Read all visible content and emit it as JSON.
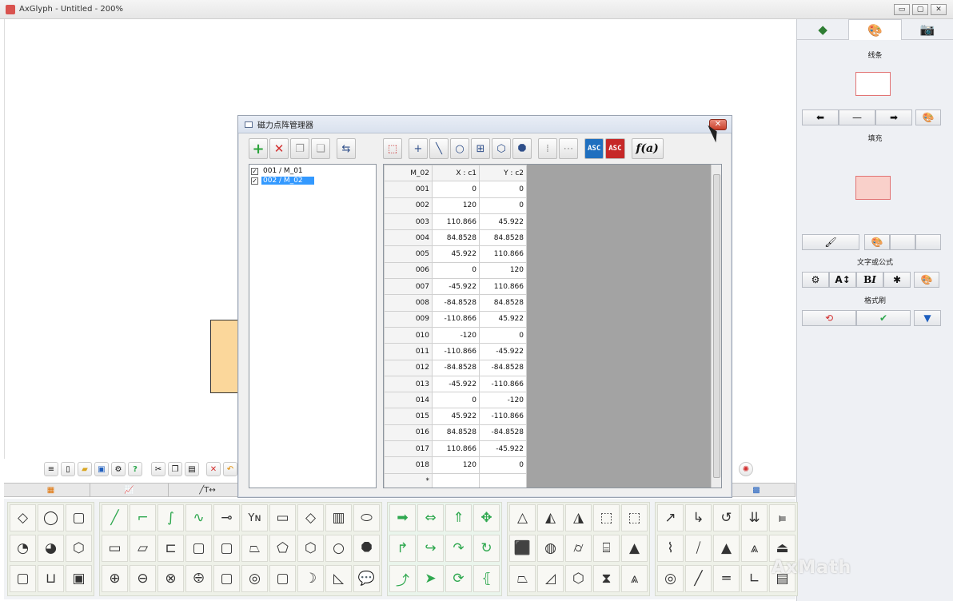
{
  "window": {
    "title": "AxGlyph - Untitled - 200%",
    "buttons": [
      "▭",
      "▢",
      "✕"
    ]
  },
  "right_panel": {
    "tabs": [
      {
        "name": "layers",
        "icon": "layers-icon",
        "glyph": "◆"
      },
      {
        "name": "style",
        "icon": "palette-icon",
        "glyph": "🎨"
      },
      {
        "name": "camera",
        "icon": "camera-icon",
        "glyph": "📷"
      }
    ],
    "line_label": "线条",
    "fill_label": "填充",
    "text_formula_label": "文字或公式",
    "format_brush_label": "格式刷",
    "colors": {
      "line_border": "#e27474",
      "fill": "#f9d0ca"
    }
  },
  "dialog": {
    "title": "磁力点阵管理器",
    "close": "✕",
    "tree": [
      {
        "label": "001 / M_01",
        "checked": "✓"
      },
      {
        "label": "002 / M_02",
        "checked": "✓"
      }
    ],
    "grid": {
      "headers": [
        "M_02",
        "X : c1",
        "Y : c2"
      ],
      "rows": [
        [
          "001",
          "0",
          "0"
        ],
        [
          "002",
          "120",
          "0"
        ],
        [
          "003",
          "110.866",
          "45.922"
        ],
        [
          "004",
          "84.8528",
          "84.8528"
        ],
        [
          "005",
          "45.922",
          "110.866"
        ],
        [
          "006",
          "0",
          "120"
        ],
        [
          "007",
          "-45.922",
          "110.866"
        ],
        [
          "008",
          "-84.8528",
          "84.8528"
        ],
        [
          "009",
          "-110.866",
          "45.922"
        ],
        [
          "010",
          "-120",
          "0"
        ],
        [
          "011",
          "-110.866",
          "-45.922"
        ],
        [
          "012",
          "-84.8528",
          "-84.8528"
        ],
        [
          "013",
          "-45.922",
          "-110.866"
        ],
        [
          "014",
          "0",
          "-120"
        ],
        [
          "015",
          "45.922",
          "-110.866"
        ],
        [
          "016",
          "84.8528",
          "-84.8528"
        ],
        [
          "017",
          "110.866",
          "-45.922"
        ],
        [
          "018",
          "120",
          "0"
        ],
        [
          "*",
          "",
          ""
        ]
      ]
    },
    "toolbar": {
      "fx_label": "f(a)",
      "asc1": "ASC",
      "asc2": "ASC"
    }
  },
  "watermark": "AxMath"
}
